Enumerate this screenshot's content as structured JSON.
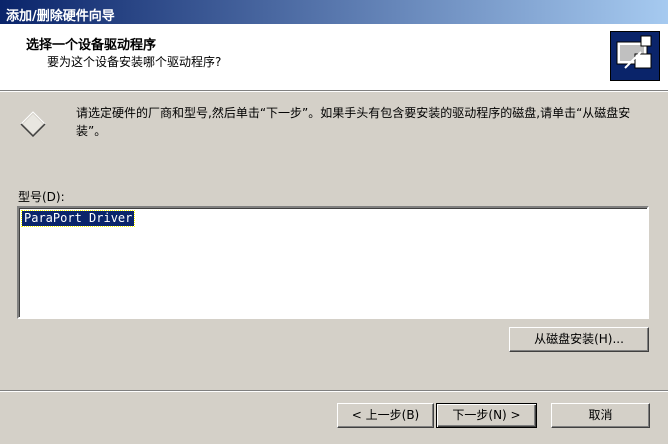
{
  "window": {
    "title": "添加/删除硬件向导"
  },
  "header": {
    "title": "选择一个设备驱动程序",
    "subtitle": "要为这个设备安装哪个驱动程序?"
  },
  "info": {
    "text": "请选定硬件的厂商和型号,然后单击“下一步”。如果手头有包含要安装的驱动程序的磁盘,请单击“从磁盘安装”。"
  },
  "model": {
    "label": "型号(D):",
    "items": [
      "ParaPort Driver"
    ],
    "selected": "ParaPort Driver"
  },
  "buttons": {
    "have_disk": "从磁盘安装(H)...",
    "back": "< 上一步(B)",
    "next": "下一步(N) >",
    "cancel": "取消"
  },
  "colors": {
    "title_active": "#0a246a",
    "face": "#d4d0c8",
    "selection": "#0a246a"
  },
  "icons": {
    "header": "hardware-wizard-icon",
    "info": "diamond-icon"
  }
}
